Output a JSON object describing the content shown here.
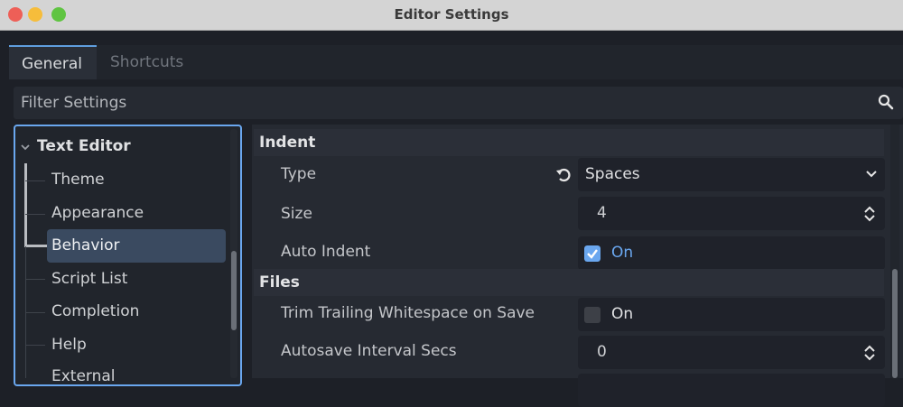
{
  "window": {
    "title": "Editor Settings"
  },
  "tabs": [
    {
      "label": "General",
      "active": true
    },
    {
      "label": "Shortcuts",
      "active": false
    }
  ],
  "filter": {
    "placeholder": "Filter Settings",
    "icon": "search-icon"
  },
  "tree": {
    "root": "Text Editor",
    "items": [
      {
        "label": "Theme"
      },
      {
        "label": "Appearance"
      },
      {
        "label": "Behavior",
        "selected": true
      },
      {
        "label": "Script List"
      },
      {
        "label": "Completion"
      },
      {
        "label": "Help"
      },
      {
        "label": "External"
      }
    ]
  },
  "sections": [
    {
      "title": "Indent",
      "properties": [
        {
          "label": "Type",
          "value": "Spaces",
          "kind": "dropdown",
          "revertable": true
        },
        {
          "label": "Size",
          "value": "4",
          "kind": "spinbox"
        },
        {
          "label": "Auto Indent",
          "value": "On",
          "kind": "checkbox",
          "checked": true
        }
      ]
    },
    {
      "title": "Files",
      "properties": [
        {
          "label": "Trim Trailing Whitespace on Save",
          "value": "On",
          "kind": "checkbox",
          "checked": false
        },
        {
          "label": "Autosave Interval Secs",
          "value": "0",
          "kind": "spinbox"
        }
      ]
    }
  ],
  "colors": {
    "accent": "#6aa7ef",
    "selection": "#3a4a60",
    "background": "#1d2027"
  }
}
